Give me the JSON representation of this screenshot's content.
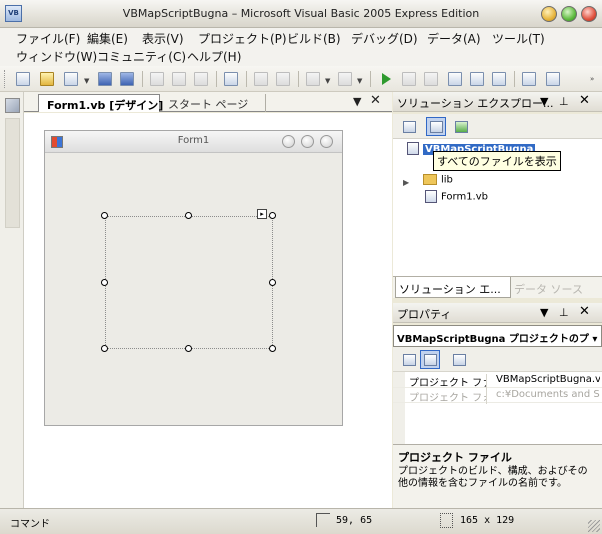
{
  "window": {
    "title": "VBMapScriptBugna – Microsoft Visual Basic 2005 Express Edition",
    "app_icon": "VB"
  },
  "menu": [
    "ファイル(F)",
    "編集(E)",
    "表示(V)",
    "プロジェクト(P)",
    "ビルド(B)",
    "デバッグ(D)",
    "データ(A)",
    "ツール(T)",
    "ウィンドウ(W)",
    "コミュニティ(C)",
    "ヘルプ(H)"
  ],
  "toolbar": {
    "icons": [
      "new-project-icon",
      "open-icon",
      "add-item-icon",
      "save-icon",
      "save-all-icon",
      "cut-icon",
      "copy-icon",
      "paste-icon",
      "find-icon",
      "comment-icon",
      "uncomment-icon",
      "undo-icon",
      "redo-icon",
      "start-icon",
      "pause-icon",
      "stop-icon",
      "step-into-icon",
      "step-over-icon",
      "step-out-icon",
      "solution-explorer-icon",
      "properties-icon"
    ]
  },
  "document": {
    "tabs": [
      {
        "label": "Form1.vb [デザイン]",
        "active": true
      },
      {
        "label": "スタート ページ",
        "active": false
      }
    ]
  },
  "form": {
    "caption": "Form1"
  },
  "solution_explorer": {
    "title": "ソリューション エクスプロー...",
    "project": "VBMapScriptBugna",
    "tooltip": "すべてのファイルを表示",
    "items": [
      {
        "label": "lib",
        "type": "folder"
      },
      {
        "label": "Form1.vb",
        "type": "vb-file"
      }
    ],
    "tabs": [
      {
        "label": "ソリューション エ...",
        "active": true
      },
      {
        "label": "データ ソース",
        "active": false
      }
    ]
  },
  "properties": {
    "title": "プロパティ",
    "selector": "VBMapScriptBugna プロジェクトのプ ▾",
    "rows": [
      {
        "name": "プロジェクト ファイ",
        "value": "VBMapScriptBugna.vb",
        "disabled": false
      },
      {
        "name": "プロジェクト フォル",
        "value": "c:¥Documents and Se",
        "disabled": true
      }
    ],
    "desc_title": "プロジェクト ファイル",
    "desc_text": "プロジェクトのビルド、構成、およびその他の情報を含むファイルの名前です。"
  },
  "status": {
    "text": "コマンド",
    "position": "59, 65",
    "size": "165 x 129"
  }
}
